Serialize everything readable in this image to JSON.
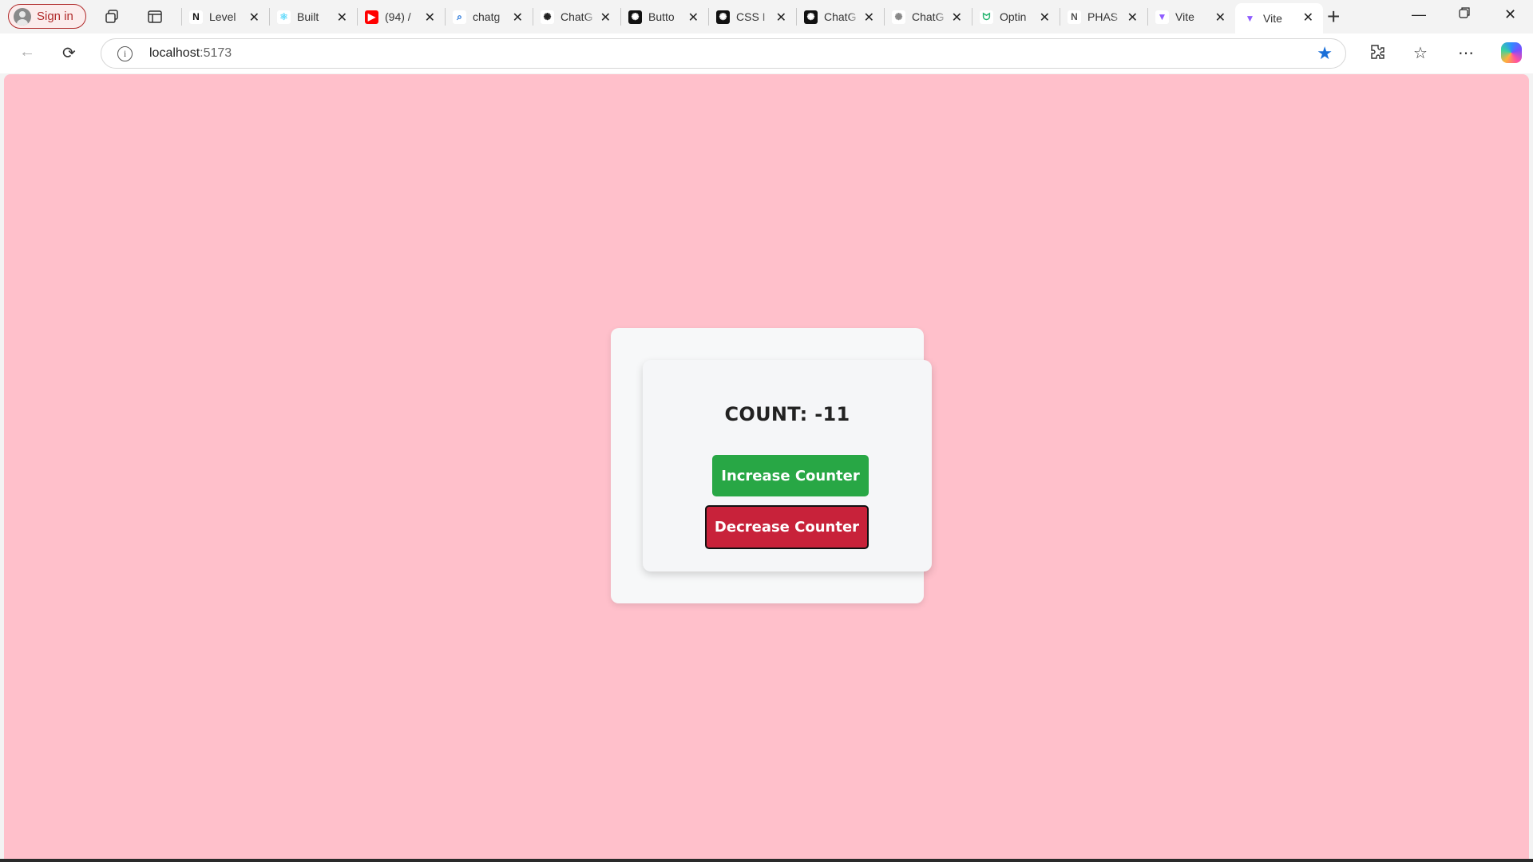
{
  "browser": {
    "signin_label": "Sign in",
    "tabs": [
      {
        "title": "Level",
        "favicon": "notion-icon",
        "fav_char": "N",
        "fav_bg": "#ffffff",
        "fav_color": "#111111"
      },
      {
        "title": "Built",
        "favicon": "react-icon",
        "fav_char": "⚛",
        "fav_bg": "#ffffff",
        "fav_color": "#61dafb"
      },
      {
        "title": "(94) /",
        "favicon": "youtube-icon",
        "fav_char": "▶",
        "fav_bg": "#ff0000",
        "fav_color": "#ffffff"
      },
      {
        "title": "chatg",
        "favicon": "search-icon",
        "fav_char": "⌕",
        "fav_bg": "#ffffff",
        "fav_color": "#1a6fd8"
      },
      {
        "title": "ChatG",
        "favicon": "openai-icon",
        "fav_char": "✺",
        "fav_bg": "#ffffff",
        "fav_color": "#222222"
      },
      {
        "title": "Butto",
        "favicon": "openai-icon",
        "fav_char": "✺",
        "fav_bg": "#111111",
        "fav_color": "#ffffff"
      },
      {
        "title": "CSS I",
        "favicon": "openai-icon",
        "fav_char": "✺",
        "fav_bg": "#111111",
        "fav_color": "#ffffff"
      },
      {
        "title": "ChatG",
        "favicon": "openai-icon",
        "fav_char": "✺",
        "fav_bg": "#111111",
        "fav_color": "#ffffff"
      },
      {
        "title": "ChatG",
        "favicon": "openai-icon",
        "fav_char": "✺",
        "fav_bg": "#ffffff",
        "fav_color": "#888888"
      },
      {
        "title": "Optin",
        "favicon": "optin-icon",
        "fav_char": "ᗢ",
        "fav_bg": "#ffffff",
        "fav_color": "#2bb673"
      },
      {
        "title": "PHAS",
        "favicon": "notion-icon",
        "fav_char": "N",
        "fav_bg": "#ffffff",
        "fav_color": "#555555"
      },
      {
        "title": "Vite",
        "favicon": "vite-icon",
        "fav_char": "▼",
        "fav_bg": "#ffffff",
        "fav_color": "#8f5cff"
      },
      {
        "title": "Vite",
        "favicon": "vite-icon",
        "fav_char": "▼",
        "fav_bg": "#ffffff",
        "fav_color": "#8f5cff",
        "active": true
      }
    ],
    "address": {
      "host": "localhost",
      "port": ":5173"
    }
  },
  "page": {
    "background_color": "#ffc0cb",
    "count_label": "COUNT: -11",
    "increase_label": "Increase Counter",
    "decrease_label": "Decrease Counter",
    "increase_color": "#28a745",
    "decrease_color": "#c8223a"
  }
}
